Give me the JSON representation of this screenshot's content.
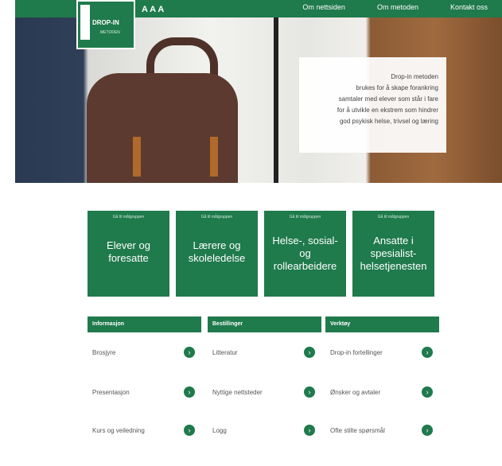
{
  "header": {
    "logo_text": "DROP-IN",
    "logo_sub": "METODEN",
    "font_size_label": "A A A",
    "nav": [
      "Om nettsiden",
      "Om metoden",
      "Kontakt oss"
    ]
  },
  "hero": {
    "lines": [
      "Drop-in metoden",
      "brukes for å skape forankring",
      "samtaler med elever som står i fare",
      "for å utvikle en ekstrem som hindrer",
      "god psykisk helse, trivsel og læring"
    ]
  },
  "tiles": [
    {
      "top": "Gå til målgruppen",
      "title": "Elever og foresatte"
    },
    {
      "top": "Gå til målgruppen",
      "title": "Lærere og skoleledelse"
    },
    {
      "top": "Gå til målgruppen",
      "title": "Helse-, sosial- og rollearbeidere"
    },
    {
      "top": "Gå til målgruppen",
      "title": "Ansatte i spesialist-helsetjenesten"
    }
  ],
  "columns": [
    {
      "header": "Informasjon",
      "items": [
        "Brosjyre",
        "Presentasjon",
        "Kurs og veiledning"
      ]
    },
    {
      "header": "Bestillinger",
      "items": [
        "Litteratur",
        "Nyttige nettsteder",
        "Logg"
      ]
    },
    {
      "header": "Verktøy",
      "items": [
        "Drop-in fortellinger",
        "Ønsker og avtaler",
        "Ofte stilte spørsmål"
      ]
    }
  ],
  "colors": {
    "brand_green": "#1f7a4c"
  }
}
